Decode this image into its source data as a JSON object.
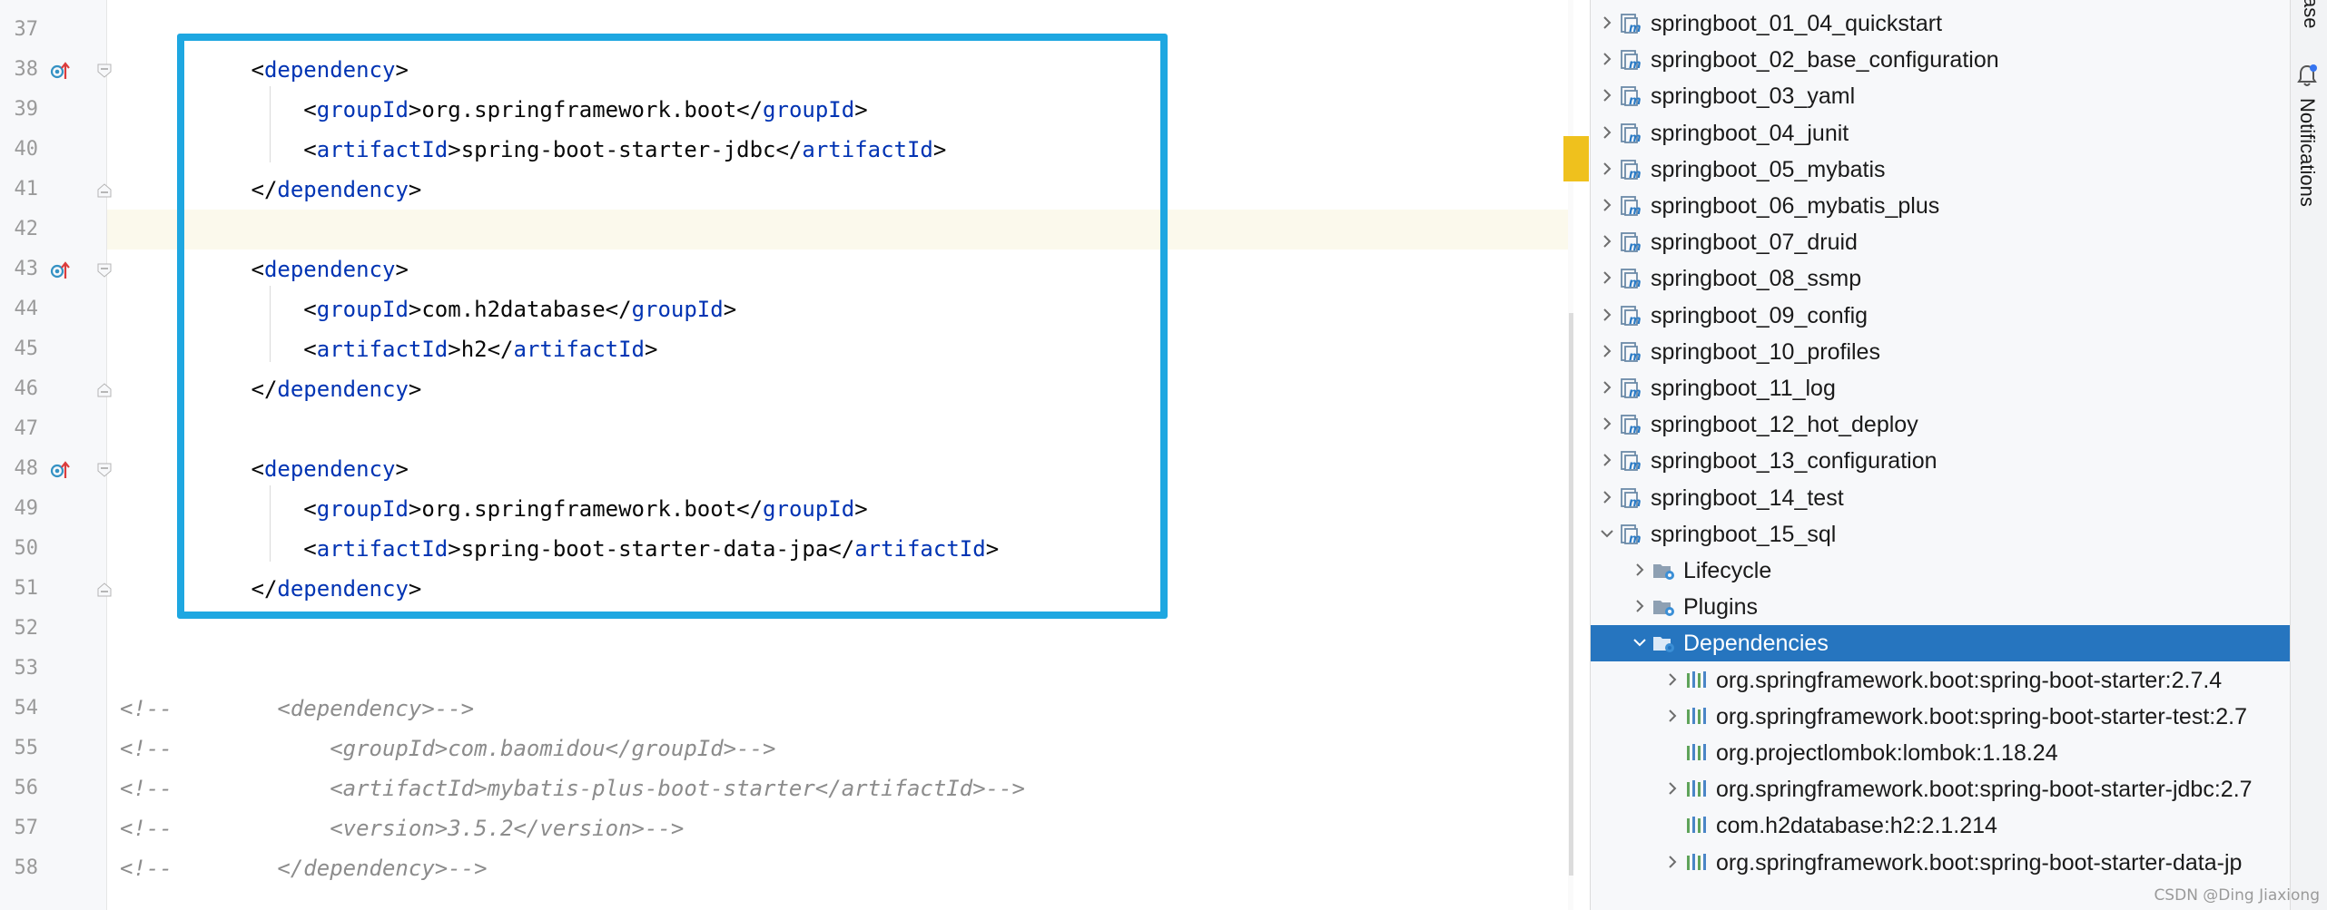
{
  "editor": {
    "lines": [
      {
        "num": "37",
        "kind": "blank",
        "text": ""
      },
      {
        "num": "38",
        "kind": "open",
        "indent": 1,
        "name": "dependency",
        "marker": true,
        "fold": "open"
      },
      {
        "num": "39",
        "kind": "elem",
        "indent": 2,
        "name": "groupId",
        "value": "org.springframework.boot"
      },
      {
        "num": "40",
        "kind": "elem",
        "indent": 2,
        "name": "artifactId",
        "value": "spring-boot-starter-jdbc"
      },
      {
        "num": "41",
        "kind": "close",
        "indent": 1,
        "name": "dependency",
        "fold": "close"
      },
      {
        "num": "42",
        "kind": "blank",
        "current": true
      },
      {
        "num": "43",
        "kind": "open",
        "indent": 1,
        "name": "dependency",
        "marker": true,
        "fold": "open"
      },
      {
        "num": "44",
        "kind": "elem",
        "indent": 2,
        "name": "groupId",
        "value": "com.h2database"
      },
      {
        "num": "45",
        "kind": "elem",
        "indent": 2,
        "name": "artifactId",
        "value": "h2"
      },
      {
        "num": "46",
        "kind": "close",
        "indent": 1,
        "name": "dependency",
        "fold": "close"
      },
      {
        "num": "47",
        "kind": "blank"
      },
      {
        "num": "48",
        "kind": "open",
        "indent": 1,
        "name": "dependency",
        "marker": true,
        "fold": "open"
      },
      {
        "num": "49",
        "kind": "elem",
        "indent": 2,
        "name": "groupId",
        "value": "org.springframework.boot"
      },
      {
        "num": "50",
        "kind": "elem",
        "indent": 2,
        "name": "artifactId",
        "value": "spring-boot-starter-data-jpa"
      },
      {
        "num": "51",
        "kind": "close",
        "indent": 1,
        "name": "dependency",
        "fold": "close"
      },
      {
        "num": "52",
        "kind": "blank"
      },
      {
        "num": "53",
        "kind": "blank"
      },
      {
        "num": "54",
        "kind": "comment",
        "text": "<!--        <dependency>-->"
      },
      {
        "num": "55",
        "kind": "comment",
        "text": "<!--            <groupId>com.baomidou</groupId>-->"
      },
      {
        "num": "56",
        "kind": "comment",
        "text": "<!--            <artifactId>mybatis-plus-boot-starter</artifactId>-->"
      },
      {
        "num": "57",
        "kind": "comment",
        "text": "<!--            <version>3.5.2</version>-->"
      },
      {
        "num": "58",
        "kind": "comment",
        "text": "<!--        </dependency>-->"
      }
    ],
    "colors": {
      "tag": "#0033b3",
      "text": "#080808",
      "comment": "#8c8c8c",
      "highlight_border": "#1ea7e1",
      "current_line": "#fbf9ec",
      "warning_stripe": "#efc11d"
    }
  },
  "maven": {
    "items": [
      {
        "label": "springboot_01_04_quickstart",
        "level": 0,
        "chevron": "right",
        "icon": "maven-module-icon"
      },
      {
        "label": "springboot_02_base_configuration",
        "level": 0,
        "chevron": "right",
        "icon": "maven-module-icon"
      },
      {
        "label": "springboot_03_yaml",
        "level": 0,
        "chevron": "right",
        "icon": "maven-module-icon"
      },
      {
        "label": "springboot_04_junit",
        "level": 0,
        "chevron": "right",
        "icon": "maven-module-icon"
      },
      {
        "label": "springboot_05_mybatis",
        "level": 0,
        "chevron": "right",
        "icon": "maven-module-icon"
      },
      {
        "label": "springboot_06_mybatis_plus",
        "level": 0,
        "chevron": "right",
        "icon": "maven-module-icon"
      },
      {
        "label": "springboot_07_druid",
        "level": 0,
        "chevron": "right",
        "icon": "maven-module-icon"
      },
      {
        "label": "springboot_08_ssmp",
        "level": 0,
        "chevron": "right",
        "icon": "maven-module-icon"
      },
      {
        "label": "springboot_09_config",
        "level": 0,
        "chevron": "right",
        "icon": "maven-module-icon"
      },
      {
        "label": "springboot_10_profiles",
        "level": 0,
        "chevron": "right",
        "icon": "maven-module-icon"
      },
      {
        "label": "springboot_11_log",
        "level": 0,
        "chevron": "right",
        "icon": "maven-module-icon"
      },
      {
        "label": "springboot_12_hot_deploy",
        "level": 0,
        "chevron": "right",
        "icon": "maven-module-icon"
      },
      {
        "label": "springboot_13_configuration",
        "level": 0,
        "chevron": "right",
        "icon": "maven-module-icon"
      },
      {
        "label": "springboot_14_test",
        "level": 0,
        "chevron": "right",
        "icon": "maven-module-icon"
      },
      {
        "label": "springboot_15_sql",
        "level": 0,
        "chevron": "down",
        "icon": "maven-module-icon"
      },
      {
        "label": "Lifecycle",
        "level": 1,
        "chevron": "right",
        "icon": "lifecycle-folder-icon"
      },
      {
        "label": "Plugins",
        "level": 1,
        "chevron": "right",
        "icon": "plugins-folder-icon"
      },
      {
        "label": "Dependencies",
        "level": 1,
        "chevron": "down",
        "icon": "dependencies-folder-icon",
        "selected": true
      },
      {
        "label": "org.springframework.boot:spring-boot-starter:2.7.4",
        "level": 2,
        "chevron": "right",
        "icon": "library-icon"
      },
      {
        "label": "org.springframework.boot:spring-boot-starter-test:2.7",
        "level": 2,
        "chevron": "right",
        "icon": "library-icon"
      },
      {
        "label": "org.projectlombok:lombok:1.18.24",
        "level": 2,
        "chevron": "none",
        "icon": "library-icon"
      },
      {
        "label": "org.springframework.boot:spring-boot-starter-jdbc:2.7",
        "level": 2,
        "chevron": "right",
        "icon": "library-icon"
      },
      {
        "label": "com.h2database:h2:2.1.214",
        "level": 2,
        "chevron": "none",
        "icon": "library-icon"
      },
      {
        "label": "org.springframework.boot:spring-boot-starter-data-jp",
        "level": 2,
        "chevron": "right",
        "icon": "library-icon"
      }
    ],
    "colors": {
      "selected_bg": "#2675bf",
      "module_icon": "#6b8aa8",
      "library_bar_green": "#5fa35a",
      "library_bar_blue": "#4a86c7"
    }
  },
  "right_strip": {
    "top_fragment": "ase",
    "notifications_label": "Notifications"
  },
  "watermark": "CSDN @Ding Jiaxiong"
}
